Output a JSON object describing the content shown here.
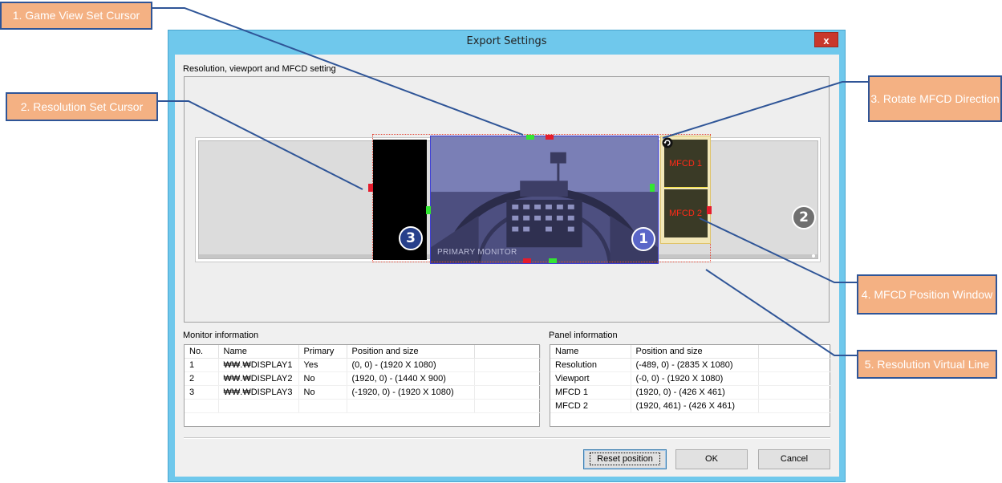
{
  "window": {
    "title": "Export Settings",
    "close_glyph": "x"
  },
  "preview": {
    "group_label": "Resolution, viewport and MFCD setting",
    "viewport_label": "PRIMARY MONITOR",
    "badges": {
      "monitor1": "1",
      "monitor2": "2",
      "monitor3": "3"
    },
    "mfcd_labels": [
      "MFCD 1",
      "MFCD 2"
    ],
    "colors": {
      "cursor_green": "#33e632",
      "cursor_red": "#e51c2c",
      "resolution_line": "#e24a3a",
      "mfcd_text": "#ff2a18",
      "viewport_border": "#3f3fd6"
    }
  },
  "monitor_info": {
    "label": "Monitor information",
    "columns": [
      "No.",
      "Name",
      "Primary",
      "Position and size",
      ""
    ],
    "rows": [
      [
        "1",
        "₩₩.₩DISPLAY1",
        "Yes",
        "(0, 0) - (1920 X 1080)",
        ""
      ],
      [
        "2",
        "₩₩.₩DISPLAY2",
        "No",
        "(1920, 0) - (1440 X 900)",
        ""
      ],
      [
        "3",
        "₩₩.₩DISPLAY3",
        "No",
        "(-1920, 0) - (1920 X 1080)",
        ""
      ]
    ]
  },
  "panel_info": {
    "label": "Panel information",
    "columns": [
      "Name",
      "Position and size",
      ""
    ],
    "rows": [
      [
        "Resolution",
        "(-489, 0) - (2835 X 1080)",
        ""
      ],
      [
        "Viewport",
        "(-0, 0) - (1920 X 1080)",
        ""
      ],
      [
        "MFCD 1",
        "(1920, 0) - (426 X 461)",
        ""
      ],
      [
        "MFCD 2",
        "(1920, 461) - (426 X 461)",
        ""
      ]
    ]
  },
  "buttons": {
    "reset": "Reset position",
    "ok": "OK",
    "cancel": "Cancel"
  },
  "callouts": [
    {
      "id": "c1",
      "text": "1. Game View Set Cursor"
    },
    {
      "id": "c2",
      "text": "2. Resolution Set Cursor"
    },
    {
      "id": "c3",
      "text": "3. Rotate MFCD Direction"
    },
    {
      "id": "c4",
      "text": "4. MFCD Position Window"
    },
    {
      "id": "c5",
      "text": "5. Resolution Virtual Line"
    }
  ],
  "callout_colors": {
    "fill": "#f4b183",
    "border": "#2f5597",
    "leader": "#2f5597"
  }
}
